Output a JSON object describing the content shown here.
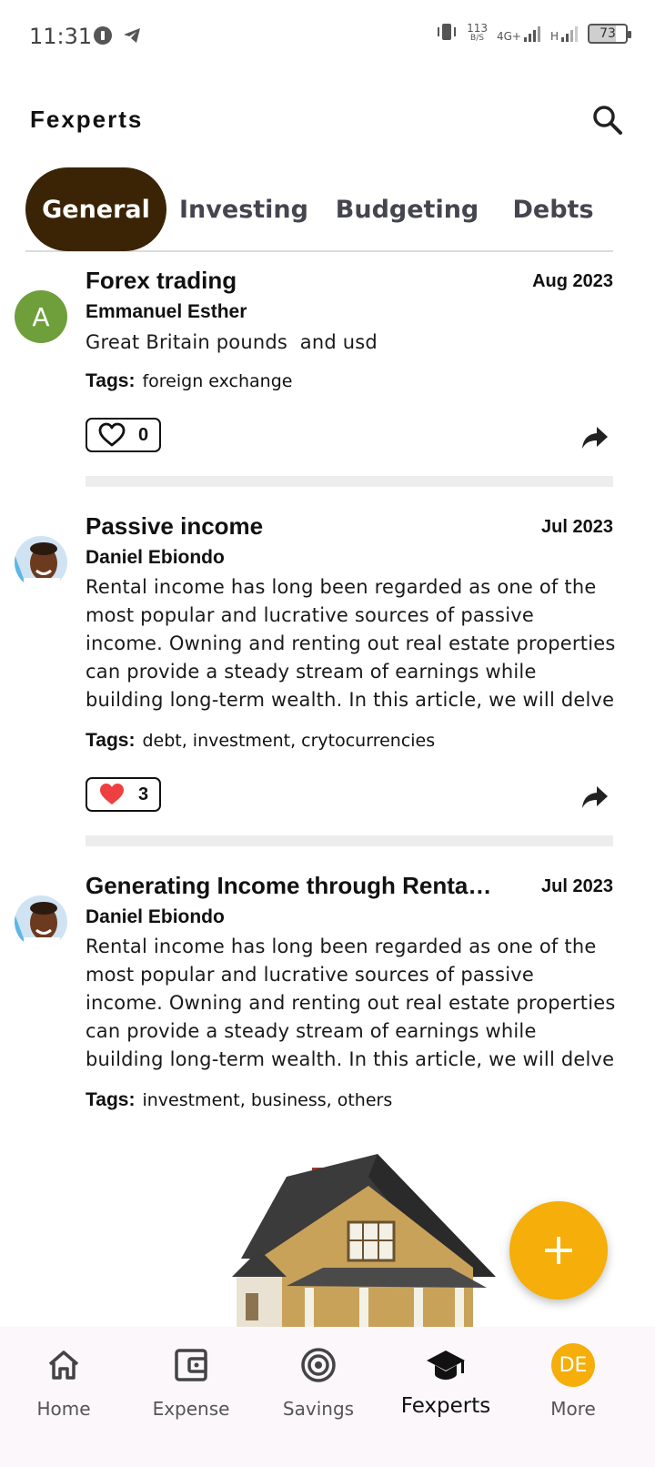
{
  "status_bar": {
    "time": "11:31",
    "net_speed_value": "113",
    "net_speed_unit": "B/S",
    "network_type": "4G+",
    "network_type_2": "H",
    "battery": "73"
  },
  "app": {
    "title": "Fexperts"
  },
  "tabs": [
    {
      "label": "General",
      "active": true
    },
    {
      "label": "Investing",
      "active": false
    },
    {
      "label": "Budgeting",
      "active": false
    },
    {
      "label": "Debts",
      "active": false
    }
  ],
  "posts": [
    {
      "avatar_letter": "A",
      "title": "Forex trading",
      "date": "Aug 2023",
      "author": "Emmanuel Esther",
      "body": "Great Britain pounds  and usd",
      "tags_label": "Tags:",
      "tags": "foreign exchange",
      "likes": "0",
      "liked": false
    },
    {
      "title": "Passive income",
      "date": "Jul 2023",
      "author": "Daniel Ebiondo",
      "body": "Rental income has long been regarded as one of the most popular and lucrative sources of passive income. Owning and renting out real estate properties can provide a steady stream of earnings while building long-term wealth. In this article, we will delve into the world of rental",
      "tags_label": "Tags:",
      "tags": "debt, investment, crytocurrencies",
      "likes": "3",
      "liked": true
    },
    {
      "title": "Generating Income through Rental Properties",
      "date": "Jul 2023",
      "author": "Daniel Ebiondo",
      "body": "Rental income has long been regarded as one of the most popular and lucrative sources of passive income. Owning and renting out real estate properties can provide a steady stream of earnings while building long-term wealth. In this article, we will delve into the world of rental",
      "tags_label": "Tags:",
      "tags": "investment, business, others"
    }
  ],
  "bottom_nav": [
    {
      "label": "Home",
      "icon": "home-icon"
    },
    {
      "label": "Expense",
      "icon": "wallet-icon"
    },
    {
      "label": "Savings",
      "icon": "target-icon"
    },
    {
      "label": "Fexperts",
      "icon": "graduation-cap-icon",
      "active": true
    },
    {
      "label": "More",
      "avatar_initials": "DE"
    }
  ],
  "colors": {
    "accent": "#f5ae0a",
    "active_tab": "#3a2405",
    "like_red": "#ee4040",
    "avatar_green": "#6e9f3a"
  }
}
